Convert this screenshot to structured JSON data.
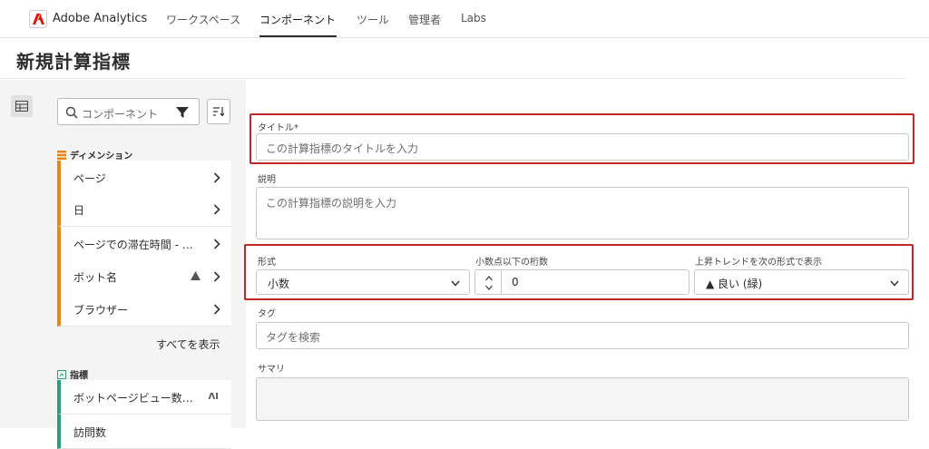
{
  "topnav": {
    "app_name": "Adobe Analytics",
    "items": [
      {
        "label": "ワークスペース"
      },
      {
        "label": "コンポーネント",
        "active": true
      },
      {
        "label": "ツール"
      },
      {
        "label": "管理者"
      },
      {
        "label": "Labs"
      }
    ]
  },
  "page": {
    "title": "新規計算指標"
  },
  "left_panel": {
    "search_placeholder": "コンポーネント",
    "dimensions": {
      "heading": "ディメンション",
      "items": [
        {
          "label": "ページ"
        },
        {
          "label": "日"
        },
        {
          "label": "ページでの滞在時間 - …"
        },
        {
          "label": "ボット名",
          "warning": true
        },
        {
          "label": "ブラウザー"
        }
      ],
      "show_all": "すべてを表示"
    },
    "metrics": {
      "heading": "指標",
      "items": [
        {
          "label": "ボットページビュー数…"
        },
        {
          "label": "訪問数"
        }
      ]
    }
  },
  "form": {
    "title_label": "タイトル",
    "title_required_mark": "*",
    "title_placeholder": "この計算指標のタイトルを入力",
    "description_label": "説明",
    "description_placeholder": "この計算指標の説明を入力",
    "format_label": "形式",
    "format_value": "小数",
    "decimals_label": "小数点以下の桁数",
    "decimals_value": "0",
    "trend_label": "上昇トレンドを次の形式で表示",
    "trend_value": "▲ 良い (緑)",
    "tags_label": "タグ",
    "tags_placeholder": "タグを検索",
    "summary_label": "サマリ"
  },
  "colors": {
    "highlight": "#c0262b",
    "dimension_accent": "#e68619",
    "metric_accent": "#2d9d78",
    "adobe_red": "#eb1000"
  }
}
